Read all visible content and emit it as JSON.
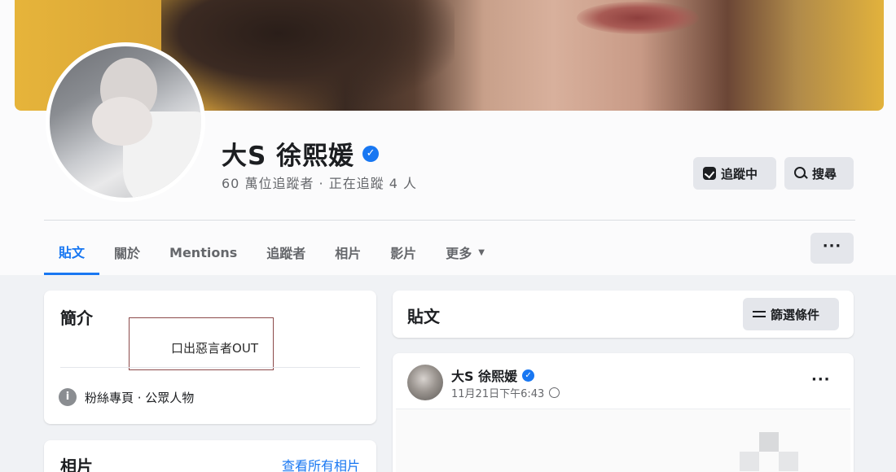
{
  "profile": {
    "name": "大S 徐熙媛",
    "followers_text": "60 萬位追蹤者 · 正在追蹤 4 人"
  },
  "actions": {
    "following_label": "追蹤中",
    "search_label": "搜尋"
  },
  "tabs": [
    {
      "label": "貼文"
    },
    {
      "label": "關於"
    },
    {
      "label": "Mentions"
    },
    {
      "label": "追蹤者"
    },
    {
      "label": "相片"
    },
    {
      "label": "影片"
    },
    {
      "label": "更多"
    }
  ],
  "more_button": "···",
  "intro": {
    "title": "簡介",
    "bio": "口出惡言者OUT",
    "page_info": "粉絲專頁 · 公眾人物"
  },
  "photos": {
    "title": "相片",
    "see_all": "查看所有相片"
  },
  "posts": {
    "title": "貼文",
    "filter_label": "篩選條件"
  },
  "post": {
    "author": "大S 徐熙媛",
    "timestamp": "11月21日下午6:43",
    "menu": "···"
  },
  "icons": {
    "verified": "✓",
    "info": "i"
  },
  "colors": {
    "accent": "#1877f2",
    "background": "#f0f2f5"
  }
}
